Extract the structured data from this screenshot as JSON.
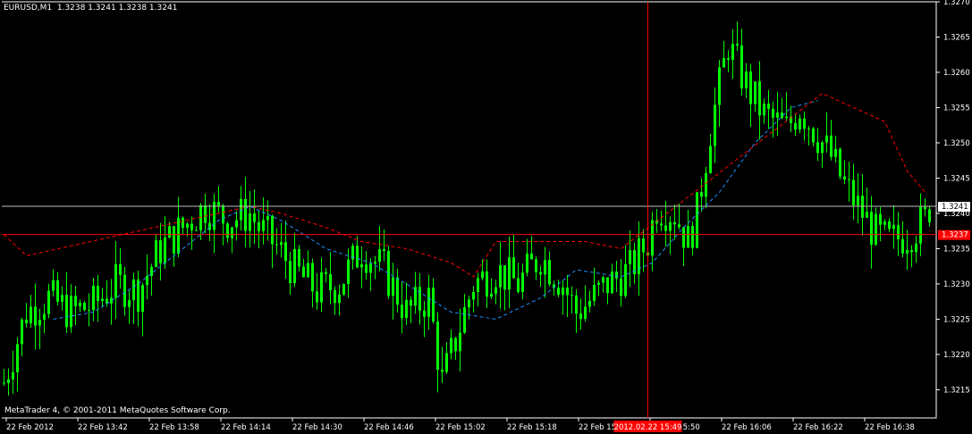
{
  "header": {
    "symbol_timeframe": "EURUSD,M1",
    "ohlc": "1.3238 1.3241 1.3238 1.3241"
  },
  "footer": {
    "copyright": "MetaTrader 4, © 2001-2011 MetaQuotes Software Corp."
  },
  "colors": {
    "background": "#000000",
    "candles": "#00ff00",
    "bid_line": "#c0c0c0",
    "crosshair": "#ff0000",
    "ma_fast": "#1e90ff",
    "ma_slow": "#ff0000",
    "label_text": "#ffffff"
  },
  "chart_data": {
    "type": "candlestick",
    "symbol": "EURUSD",
    "timeframe": "M1",
    "ylim": [
      1.3211,
      1.327
    ],
    "y_ticks": [
      "1.3270",
      "1.3265",
      "1.3260",
      "1.3255",
      "1.3250",
      "1.3245",
      "1.3240",
      "1.3235",
      "1.3230",
      "1.3225",
      "1.3220",
      "1.3215"
    ],
    "x_labels": [
      "22 Feb 2012",
      "22 Feb 13:42",
      "22 Feb 13:58",
      "22 Feb 14:14",
      "22 Feb 14:30",
      "22 Feb 14:46",
      "22 Feb 15:02",
      "22 Feb 15:18",
      "22 Feb 15:34",
      "22 Feb 15:50",
      "22 Feb 16:06",
      "22 Feb 16:22",
      "22 Feb 16:38"
    ],
    "current_price": 1.3241,
    "current_price_label": "1.3241",
    "crosshair_price": 1.3237,
    "crosshair_price_label": "1.3237",
    "crosshair_time_label": "2012.02.22 15:49",
    "crosshair_index": 144,
    "close_path": [
      [
        0,
        1.3216
      ],
      [
        5,
        1.3226
      ],
      [
        10,
        1.3228
      ],
      [
        15,
        1.3226
      ],
      [
        20,
        1.3227
      ],
      [
        25,
        1.323
      ],
      [
        30,
        1.3229
      ],
      [
        35,
        1.3235
      ],
      [
        40,
        1.3238
      ],
      [
        45,
        1.3241
      ],
      [
        50,
        1.3239
      ],
      [
        55,
        1.324
      ],
      [
        57,
        1.3238
      ],
      [
        60,
        1.3236
      ],
      [
        65,
        1.3232
      ],
      [
        70,
        1.3229
      ],
      [
        75,
        1.323
      ],
      [
        80,
        1.3235
      ],
      [
        85,
        1.3232
      ],
      [
        90,
        1.3226
      ],
      [
        95,
        1.3228
      ],
      [
        98,
        1.3216
      ],
      [
        100,
        1.322
      ],
      [
        105,
        1.323
      ],
      [
        110,
        1.3232
      ],
      [
        115,
        1.323
      ],
      [
        120,
        1.3234
      ],
      [
        125,
        1.323
      ],
      [
        128,
        1.3226
      ],
      [
        130,
        1.3227
      ],
      [
        135,
        1.323
      ],
      [
        140,
        1.3232
      ],
      [
        144,
        1.3236
      ],
      [
        146,
        1.3241
      ],
      [
        150,
        1.324
      ],
      [
        153,
        1.3236
      ],
      [
        155,
        1.324
      ],
      [
        158,
        1.3252
      ],
      [
        160,
        1.3258
      ],
      [
        162,
        1.3264
      ],
      [
        164,
        1.3261
      ],
      [
        167,
        1.3257
      ],
      [
        170,
        1.3254
      ],
      [
        175,
        1.3252
      ],
      [
        178,
        1.3255
      ],
      [
        180,
        1.3253
      ],
      [
        185,
        1.3248
      ],
      [
        188,
        1.3244
      ],
      [
        192,
        1.324
      ],
      [
        195,
        1.3237
      ],
      [
        198,
        1.3236
      ],
      [
        202,
        1.3237
      ],
      [
        206,
        1.3239
      ],
      [
        207,
        1.3241
      ]
    ],
    "ma_fast": [
      [
        11,
        1.3225
      ],
      [
        20,
        1.3226
      ],
      [
        30,
        1.323
      ],
      [
        40,
        1.3235
      ],
      [
        48,
        1.3239
      ],
      [
        55,
        1.3241
      ],
      [
        62,
        1.3239
      ],
      [
        72,
        1.3235
      ],
      [
        82,
        1.3233
      ],
      [
        90,
        1.323
      ],
      [
        100,
        1.3226
      ],
      [
        110,
        1.3225
      ],
      [
        120,
        1.3228
      ],
      [
        128,
        1.3232
      ],
      [
        138,
        1.3231
      ],
      [
        145,
        1.3233
      ],
      [
        152,
        1.3238
      ],
      [
        160,
        1.3243
      ],
      [
        168,
        1.325
      ],
      [
        176,
        1.3255
      ],
      [
        182,
        1.3256
      ]
    ],
    "ma_slow": [
      [
        0,
        1.3237
      ],
      [
        5,
        1.3234
      ],
      [
        55,
        1.3241
      ],
      [
        62,
        1.324
      ],
      [
        72,
        1.3238
      ],
      [
        80,
        1.3236
      ],
      [
        90,
        1.3235
      ],
      [
        100,
        1.3233
      ],
      [
        105,
        1.3231
      ],
      [
        110,
        1.3236
      ],
      [
        120,
        1.3236
      ],
      [
        130,
        1.3236
      ],
      [
        138,
        1.3235
      ],
      [
        183,
        1.3257
      ],
      [
        190,
        1.3255
      ],
      [
        197,
        1.3253
      ],
      [
        202,
        1.3246
      ],
      [
        206,
        1.3243
      ]
    ]
  }
}
